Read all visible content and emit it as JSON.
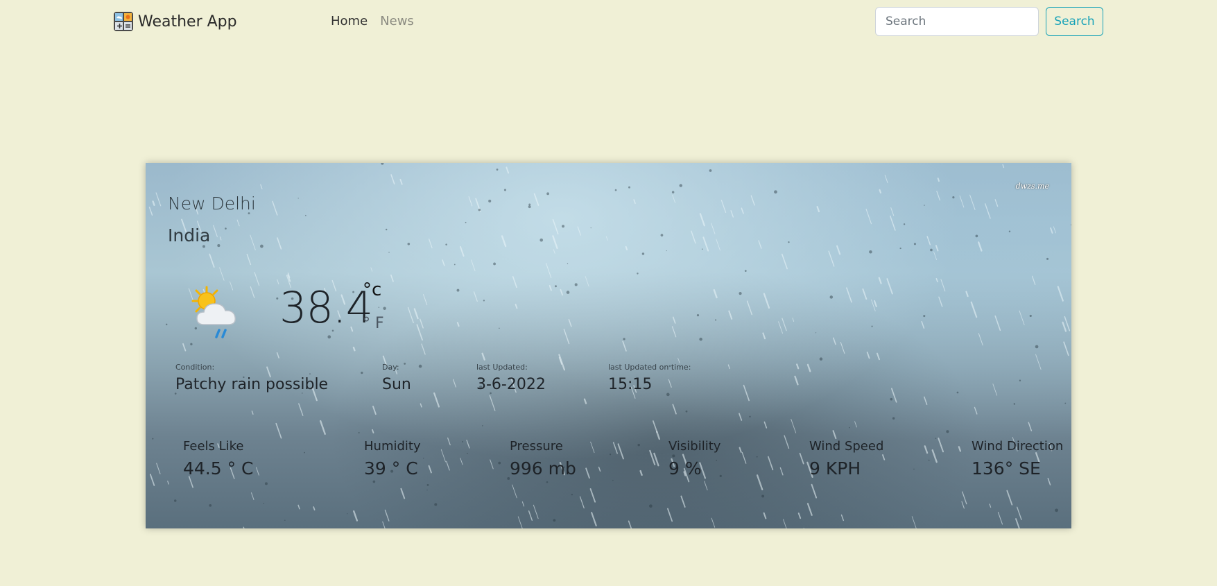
{
  "navbar": {
    "brand": "Weather App",
    "links": [
      {
        "label": "Home"
      },
      {
        "label": "News"
      }
    ],
    "search_placeholder": "Search",
    "search_button": "Search"
  },
  "card": {
    "watermark": "dwzs.me",
    "city": "New Delhi",
    "country": "India",
    "icon": "partly-cloudy-rain-icon",
    "temperature": "38.4",
    "unit_c": "°c",
    "unit_f": "° F",
    "info": [
      {
        "label": "Condition:",
        "value": "Patchy rain possible"
      },
      {
        "label": "Day:",
        "value": "Sun"
      },
      {
        "label": "last Updated:",
        "value": "3-6-2022"
      },
      {
        "label": "last Updated on time:",
        "value": "15:15"
      }
    ],
    "stats": [
      {
        "label": "Feels Like",
        "value": "44.5 ° C"
      },
      {
        "label": "Humidity",
        "value": "39 ° C"
      },
      {
        "label": "Pressure",
        "value": "996 mb"
      },
      {
        "label": "Visibility",
        "value": "9 %"
      },
      {
        "label": "Wind Speed",
        "value": "9 KPH"
      },
      {
        "label": "Wind Direction",
        "value": "136° SE"
      }
    ]
  }
}
